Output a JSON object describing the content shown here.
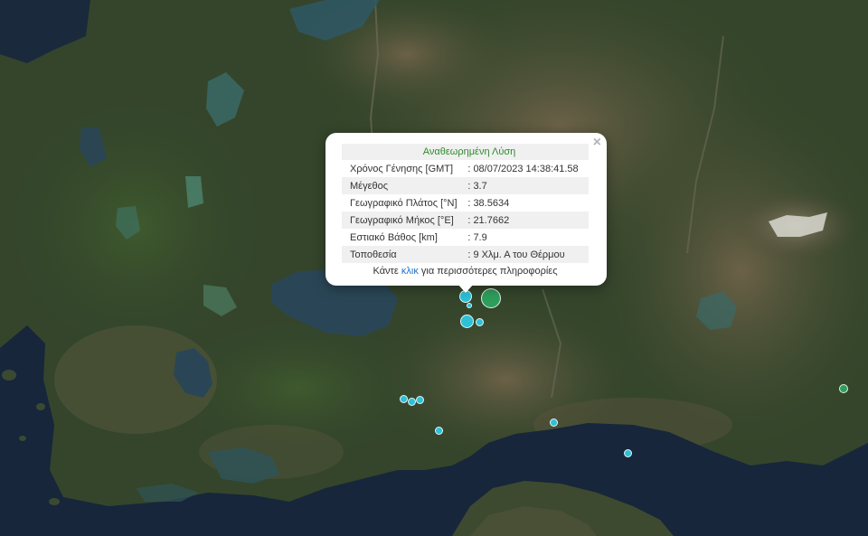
{
  "map": {
    "colors": {
      "sea": "#18273a",
      "lake": "#2b4858",
      "land": "#3a4d2e",
      "mountain": "#55563f"
    },
    "markers": [
      {
        "id": "m1",
        "color": "#2ec0d6",
        "size": "medium"
      },
      {
        "id": "m2",
        "color": "#2e9e5c",
        "size": "large"
      },
      {
        "id": "m3",
        "color": "#2ec0d6",
        "size": "small"
      },
      {
        "id": "m4",
        "color": "#2ec0d6",
        "size": "medium"
      },
      {
        "id": "m5",
        "color": "#2ec0d6",
        "size": "small"
      },
      {
        "id": "m6",
        "color": "#2ec0d6",
        "size": "small"
      },
      {
        "id": "m7",
        "color": "#2ec0d6",
        "size": "small"
      },
      {
        "id": "m8",
        "color": "#2ec0d6",
        "size": "small"
      },
      {
        "id": "m9",
        "color": "#2ec0d6",
        "size": "small"
      },
      {
        "id": "m10",
        "color": "#2ec0d6",
        "size": "small"
      },
      {
        "id": "m11",
        "color": "#2ec0d6",
        "size": "small"
      },
      {
        "id": "m12",
        "color": "#2e9e5c",
        "size": "small"
      }
    ]
  },
  "popup": {
    "title": "Αναθεωρημένη Λύση",
    "rows": [
      {
        "label": "Χρόνος Γένησης [GMT]",
        "value": ": 08/07/2023 14:38:41.58"
      },
      {
        "label": "Μέγεθος",
        "value": ": 3.7"
      },
      {
        "label": "Γεωγραφικό Πλάτος [°N]",
        "value": ": 38.5634"
      },
      {
        "label": "Γεωγραφικό Μήκος [°E]",
        "value": ": 21.7662"
      },
      {
        "label": "Εστιακό Βάθος [km]",
        "value": ": 7.9"
      },
      {
        "label": "Τοποθεσία",
        "value": ": 9 Χλμ. Α του Θέρμου"
      }
    ],
    "more_prefix": "Κάντε",
    "more_link": "κλικ",
    "more_suffix": "για περισσότερες πληροφορίες",
    "close_symbol": "×"
  }
}
